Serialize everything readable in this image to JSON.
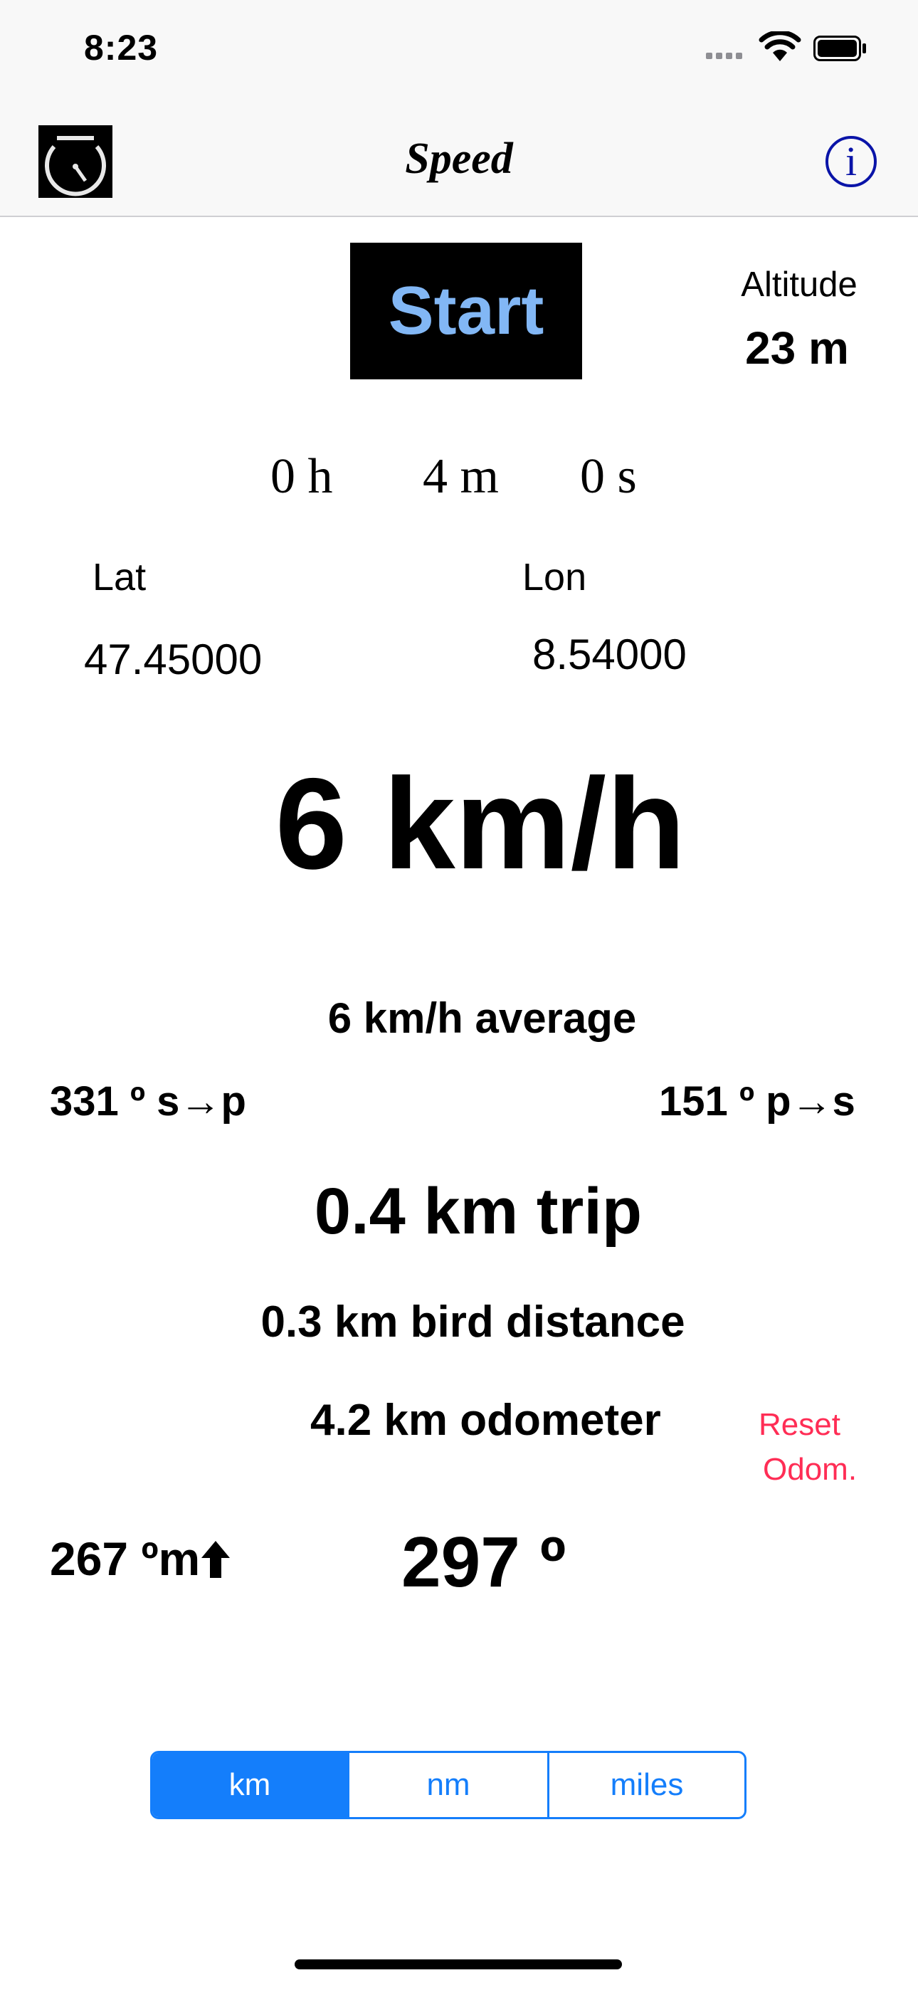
{
  "status_bar": {
    "time": "8:23",
    "icons": [
      "cellular-signal-icon",
      "wifi-icon",
      "battery-icon"
    ]
  },
  "nav": {
    "title": "Speed",
    "left_icon": "speedometer-icon",
    "right_icon": "info-icon",
    "info_glyph": "i"
  },
  "controls": {
    "start_label": "Start"
  },
  "altitude": {
    "label": "Altitude",
    "value": "23 m"
  },
  "timer": {
    "hours": "0 h",
    "minutes": "4 m",
    "seconds": "0 s"
  },
  "position": {
    "lat_label": "Lat",
    "lon_label": "Lon",
    "lat_value": "47.45000",
    "lon_value": "8.54000"
  },
  "speed": {
    "current": "6 km/h",
    "average": "6 km/h average"
  },
  "bearings": {
    "start_to_position": "331 º s→p",
    "position_to_start": "151 º p→s"
  },
  "distances": {
    "trip": "0.4 km trip",
    "bird": "0.3 km bird distance",
    "odometer": "4.2 km odometer",
    "reset_line1": "Reset",
    "reset_line2": "Odom."
  },
  "elevation": {
    "gain": "267 ºm",
    "arrow": "🠅"
  },
  "heading": "297 º",
  "units": {
    "options": [
      "km",
      "nm",
      "miles"
    ],
    "selected": "km"
  },
  "colors": {
    "accent": "#147efb",
    "start_text": "#82b7f5",
    "reset": "#ff2d55",
    "info": "#0a14a8"
  }
}
